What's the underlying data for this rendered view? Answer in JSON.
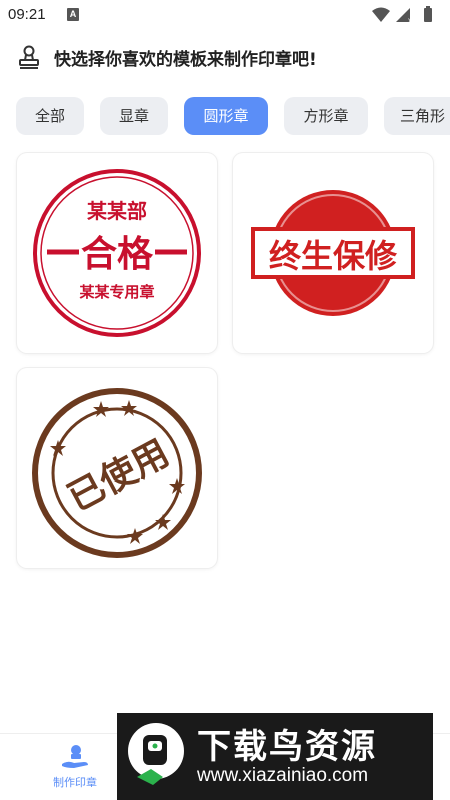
{
  "status_bar": {
    "time": "09:21",
    "notification_badge": "A"
  },
  "header": {
    "title": "快选择你喜欢的模板来制作印章吧!"
  },
  "tabs": [
    {
      "label": "全部",
      "active": false
    },
    {
      "label": "显章",
      "active": false
    },
    {
      "label": "圆形章",
      "active": true
    },
    {
      "label": "方形章",
      "active": false
    },
    {
      "label": "三角形",
      "active": false
    }
  ],
  "templates": [
    {
      "top_text": "某某部",
      "main_text": "合格",
      "bottom_text": "某某专用章",
      "color": "#c8102e"
    },
    {
      "main_text": "终生保修",
      "color": "#d02020"
    },
    {
      "main_text": "已使用",
      "color": "#6b3a1f"
    }
  ],
  "bottom_nav": {
    "items": [
      {
        "label": "制作印章",
        "active": true
      }
    ]
  },
  "watermark": {
    "title": "下载鸟资源",
    "url": "www.xiazainiao.com"
  },
  "colors": {
    "accent": "#5b8ef7",
    "tab_bg": "#eceef2"
  }
}
